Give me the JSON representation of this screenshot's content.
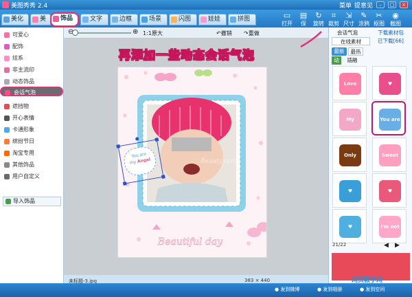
{
  "app": {
    "title": "美图秀秀 2.4"
  },
  "titlebar": {
    "menu_label": "菜单",
    "feedback_label": "提意见"
  },
  "tabs": [
    {
      "label": "美化",
      "color": "#5aa0e0"
    },
    {
      "label": "美",
      "color": "#ff7fae"
    },
    {
      "label": "饰品",
      "color": "#f25c9a",
      "active": true
    },
    {
      "label": "文字",
      "color": "#7ab4f0"
    },
    {
      "label": "边框",
      "color": "#76b6e8"
    },
    {
      "label": "场景",
      "color": "#4fa3dd"
    },
    {
      "label": "闪图",
      "color": "#ffb05a"
    },
    {
      "label": "娃娃",
      "color": "#f59ad0"
    },
    {
      "label": "拼图",
      "color": "#5fb1ea"
    }
  ],
  "toolbar": [
    "打开",
    "保",
    "旋转",
    "裁剪",
    "尺寸",
    "涂鸦",
    "抠图",
    "截图"
  ],
  "subbar": {
    "zoom_text": "1:1原大",
    "undo_label": "撤销",
    "redo_label": "重做"
  },
  "sidebar": {
    "items": [
      {
        "label": "可爱心",
        "color": "#ff6fa6"
      },
      {
        "label": "配饰",
        "color": "#d85fc7"
      },
      {
        "label": "炫系",
        "color": "#ff8ec2"
      },
      {
        "label": "非主流印",
        "color": "#e26fa4"
      },
      {
        "label": "动态饰品",
        "color": "#aab"
      },
      {
        "label": "会话气泡",
        "color": "#ff4a86",
        "selected": true
      },
      {
        "label": "遮挡物",
        "color": "#e45050"
      },
      {
        "label": "开心表情",
        "color": "#555"
      },
      {
        "label": "卡通形象",
        "color": "#4ea9e6"
      },
      {
        "label": "缤纷节日",
        "color": "#ff7b3a"
      },
      {
        "label": "淘宝专用",
        "color": "#ff6a00"
      },
      {
        "label": "其他饰品",
        "color": "#888"
      },
      {
        "label": "用户自定义",
        "color": "#6a6a6a"
      }
    ],
    "import_label": "导入饰品"
  },
  "canvas": {
    "heading": "再添加一些动态会话气泡",
    "sticker_text": {
      "line1": "You are",
      "line2": "my",
      "line3": "Angel"
    },
    "frame_caption": "Beautiful day",
    "watermark": "Beauty.com"
  },
  "status": {
    "filename": "未标题-3.jpg",
    "size_text": "383 × 440"
  },
  "rpanel": {
    "header_label": "会话气泡",
    "download_link": "下载素材包",
    "online_tab": "在线素材",
    "downloaded_tab": "已下载[66]",
    "sort_new": "最新",
    "sort_hot": "最热",
    "dynamic_label": "动态",
    "dynamic_check": "插融",
    "stickers": [
      {
        "label": "Love You",
        "color": "#ff7fa8"
      },
      {
        "label": "♥",
        "color": "#e94f8a"
      },
      {
        "label": "My Love",
        "color": "#f2a8c6"
      },
      {
        "label": "You are my Angel",
        "color": "#6aaee6",
        "highlight": true
      },
      {
        "label": "Only You",
        "color": "#7b3b12"
      },
      {
        "label": "Sweet Love",
        "color": "#ff9fbf"
      },
      {
        "label": "♥",
        "color": "#3a9ed8"
      },
      {
        "label": "♥",
        "color": "#e95a7a"
      },
      {
        "label": "♥",
        "color": "#4fb0e0"
      },
      {
        "label": "I'm not alone",
        "color": "#ffa6c9"
      }
    ],
    "pager": "21/22"
  },
  "bottombar": {
    "share_weibo": "发到微博",
    "share_album": "发到相册",
    "share_space": "发到空间",
    "watermark": "网页教学网"
  }
}
